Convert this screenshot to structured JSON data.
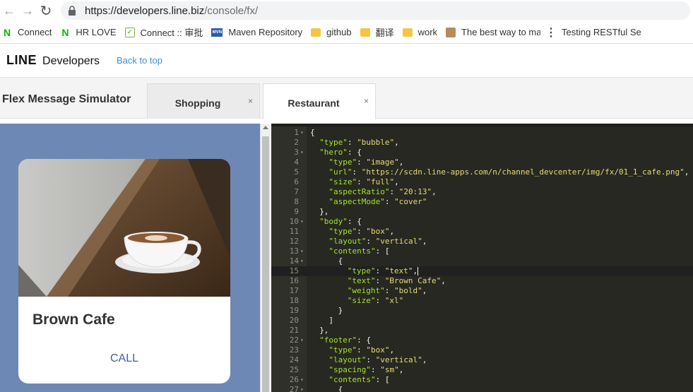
{
  "browser": {
    "url_host": "https://developers.line.biz",
    "url_path": "/console/fx/"
  },
  "bookmarks": [
    {
      "label": "Connect",
      "icon": "line-n-icon"
    },
    {
      "label": "HR LOVE",
      "icon": "line-n-icon"
    },
    {
      "label": "Connect :: 审批",
      "icon": "checklist-icon"
    },
    {
      "label": "Maven Repository",
      "icon": "mvn-icon"
    },
    {
      "label": "github",
      "icon": "folder-icon"
    },
    {
      "label": "翻译",
      "icon": "folder-icon"
    },
    {
      "label": "work",
      "icon": "folder-icon"
    },
    {
      "label": "The best way to ma",
      "icon": "avatar-icon"
    },
    {
      "label": "Testing RESTful Ser",
      "icon": "more-dots-icon"
    }
  ],
  "header": {
    "logo_line": "LINE",
    "logo_developers": "Developers",
    "back_link": "Back to top"
  },
  "simulator": {
    "title": "Flex Message Simulator",
    "tabs": [
      {
        "label": "Shopping",
        "close": "×"
      },
      {
        "label": "Restaurant",
        "close": "×"
      }
    ],
    "active_tab": 1
  },
  "preview": {
    "card_title": "Brown Cafe",
    "action_label": "CALL",
    "background_color": "#6d88b5",
    "action_color": "#3e5fa0"
  },
  "editor": {
    "active_line": 15,
    "lines": [
      {
        "n": 1,
        "fold": true,
        "indent": 0,
        "text": "{"
      },
      {
        "n": 2,
        "fold": false,
        "indent": 1,
        "key": "type",
        "value": "\"bubble\"",
        "tail": ","
      },
      {
        "n": 3,
        "fold": true,
        "indent": 1,
        "key": "hero",
        "value": "{",
        "tail": ""
      },
      {
        "n": 4,
        "fold": false,
        "indent": 2,
        "key": "type",
        "value": "\"image\"",
        "tail": ","
      },
      {
        "n": 5,
        "fold": false,
        "indent": 2,
        "key": "url",
        "value": "\"https://scdn.line-apps.com/n/channel_devcenter/img/fx/01_1_cafe.png\"",
        "tail": ","
      },
      {
        "n": 6,
        "fold": false,
        "indent": 2,
        "key": "size",
        "value": "\"full\"",
        "tail": ","
      },
      {
        "n": 7,
        "fold": false,
        "indent": 2,
        "key": "aspectRatio",
        "value": "\"20:13\"",
        "tail": ","
      },
      {
        "n": 8,
        "fold": false,
        "indent": 2,
        "key": "aspectMode",
        "value": "\"cover\"",
        "tail": ""
      },
      {
        "n": 9,
        "fold": false,
        "indent": 1,
        "text": "},"
      },
      {
        "n": 10,
        "fold": true,
        "indent": 1,
        "key": "body",
        "value": "{",
        "tail": ""
      },
      {
        "n": 11,
        "fold": false,
        "indent": 2,
        "key": "type",
        "value": "\"box\"",
        "tail": ","
      },
      {
        "n": 12,
        "fold": false,
        "indent": 2,
        "key": "layout",
        "value": "\"vertical\"",
        "tail": ","
      },
      {
        "n": 13,
        "fold": true,
        "indent": 2,
        "key": "contents",
        "value": "[",
        "tail": ""
      },
      {
        "n": 14,
        "fold": true,
        "indent": 3,
        "text": "{"
      },
      {
        "n": 15,
        "fold": false,
        "indent": 4,
        "key": "type",
        "value": "\"text\"",
        "tail": ",",
        "cursor": true
      },
      {
        "n": 16,
        "fold": false,
        "indent": 4,
        "key": "text",
        "value": "\"Brown Cafe\"",
        "tail": ","
      },
      {
        "n": 17,
        "fold": false,
        "indent": 4,
        "key": "weight",
        "value": "\"bold\"",
        "tail": ","
      },
      {
        "n": 18,
        "fold": false,
        "indent": 4,
        "key": "size",
        "value": "\"xl\"",
        "tail": ""
      },
      {
        "n": 19,
        "fold": false,
        "indent": 3,
        "text": "}"
      },
      {
        "n": 20,
        "fold": false,
        "indent": 2,
        "text": "]"
      },
      {
        "n": 21,
        "fold": false,
        "indent": 1,
        "text": "},"
      },
      {
        "n": 22,
        "fold": true,
        "indent": 1,
        "key": "footer",
        "value": "{",
        "tail": ""
      },
      {
        "n": 23,
        "fold": false,
        "indent": 2,
        "key": "type",
        "value": "\"box\"",
        "tail": ","
      },
      {
        "n": 24,
        "fold": false,
        "indent": 2,
        "key": "layout",
        "value": "\"vertical\"",
        "tail": ","
      },
      {
        "n": 25,
        "fold": false,
        "indent": 2,
        "key": "spacing",
        "value": "\"sm\"",
        "tail": ","
      },
      {
        "n": 26,
        "fold": true,
        "indent": 2,
        "key": "contents",
        "value": "[",
        "tail": ""
      },
      {
        "n": 27,
        "fold": true,
        "indent": 3,
        "text": "{"
      }
    ],
    "colors": {
      "background": "#272822",
      "key": "#a6e22e",
      "string": "#e6db74",
      "text": "#f8f8f2"
    }
  }
}
